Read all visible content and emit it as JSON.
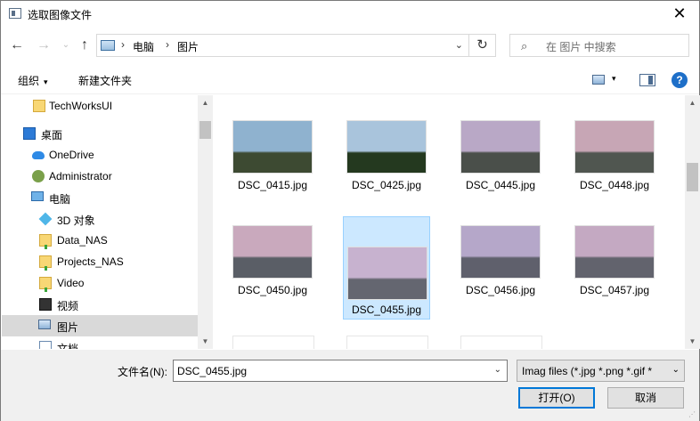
{
  "window": {
    "title": "选取图像文件",
    "close_label": "✕"
  },
  "nav": {
    "back": "←",
    "forward": "→",
    "recent": "⌄",
    "up": "↑",
    "path": [
      "电脑",
      "图片"
    ],
    "path_sep": "›",
    "address_dropdown": "⌄",
    "refresh": "↻",
    "search_icon": "⌕",
    "search_placeholder": "在 图片 中搜索"
  },
  "commands": {
    "organize": "组织",
    "new_folder": "新建文件夹",
    "caret": "▾"
  },
  "tree": {
    "items": [
      {
        "label": "TechWorksUI",
        "icon": "folder-icon"
      },
      {
        "label": "桌面",
        "icon": "desktop-icon"
      },
      {
        "label": "OneDrive",
        "icon": "cloud-icon"
      },
      {
        "label": "Administrator",
        "icon": "user-icon"
      },
      {
        "label": "电脑",
        "icon": "computer-icon"
      },
      {
        "label": "3D 对象",
        "icon": "3d-objects-icon"
      },
      {
        "label": "Data_NAS",
        "icon": "network-folder-icon"
      },
      {
        "label": "Projects_NAS",
        "icon": "network-folder-icon"
      },
      {
        "label": "Video",
        "icon": "network-folder-icon"
      },
      {
        "label": "视频",
        "icon": "videos-icon"
      },
      {
        "label": "图片",
        "icon": "pictures-icon",
        "selected": true
      },
      {
        "label": "文档",
        "icon": "documents-icon"
      }
    ]
  },
  "files": [
    {
      "name": "DSC_0415.jpg",
      "sky": "#8fb2cf",
      "ground": "#3d4a32"
    },
    {
      "name": "DSC_0425.jpg",
      "sky": "#a9c4dc",
      "ground": "#24391f"
    },
    {
      "name": "DSC_0445.jpg",
      "sky": "#b9a8c6",
      "ground": "#4a4f4a"
    },
    {
      "name": "DSC_0448.jpg",
      "sky": "#c7a6b5",
      "ground": "#505650"
    },
    {
      "name": "DSC_0450.jpg",
      "sky": "#c9a9bd",
      "ground": "#5a5e66"
    },
    {
      "name": "DSC_0455.jpg",
      "sky": "#c7b2cf",
      "ground": "#646670",
      "selected": true
    },
    {
      "name": "DSC_0456.jpg",
      "sky": "#b5a7c9",
      "ground": "#5f606c"
    },
    {
      "name": "DSC_0457.jpg",
      "sky": "#c4a9c2",
      "ground": "#62636d"
    }
  ],
  "bottom": {
    "filename_label": "文件名(N):",
    "filename_value": "DSC_0455.jpg",
    "filter_value": "Imag files (*.jpg *.png *.gif *",
    "open_label": "打开(O)",
    "cancel_label": "取消",
    "dropdown": "⌄"
  },
  "scroll": {
    "up": "▲",
    "down": "▼"
  },
  "colors": {
    "selection": "#cce8ff",
    "selection_border": "#99d1ff",
    "accent": "#0078d7"
  }
}
